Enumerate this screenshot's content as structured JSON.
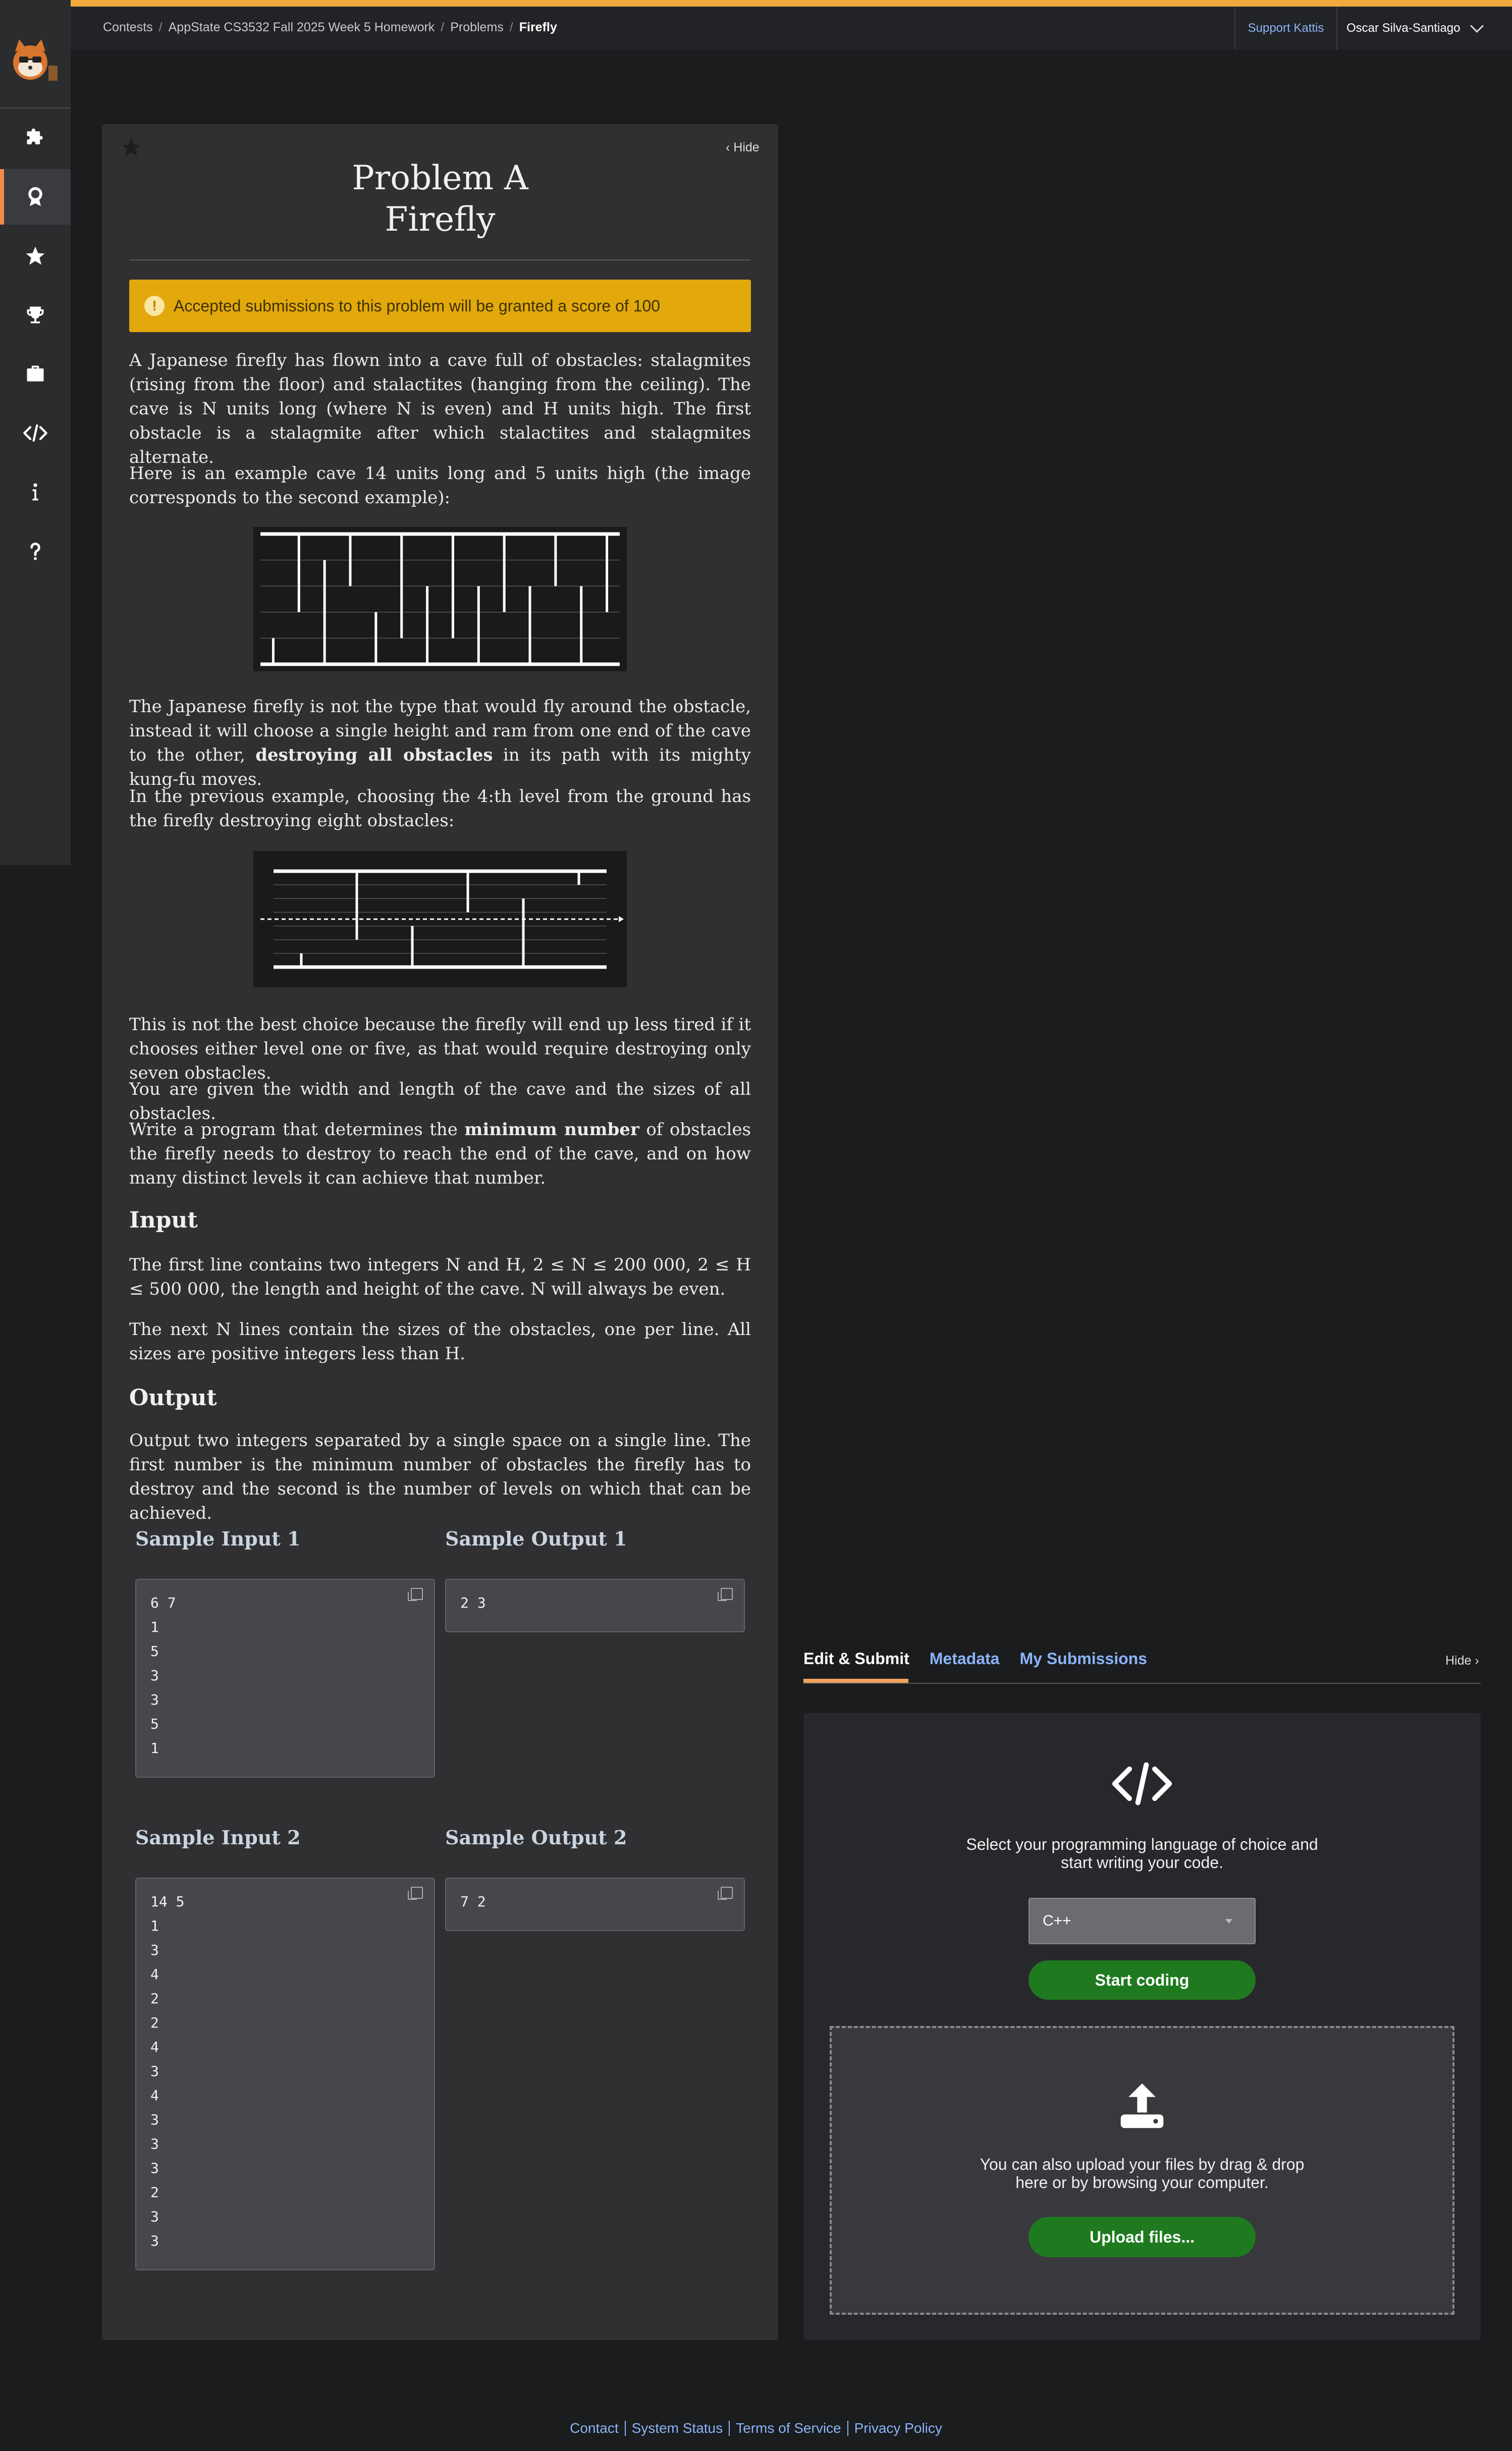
{
  "breadcrumb": {
    "contests": "Contests",
    "contest": "AppState CS3532 Fall 2025 Week 5 Homework",
    "problems": "Problems",
    "current": "Firefly",
    "sep": "/"
  },
  "header": {
    "support": "Support Kattis",
    "user": "Oscar Silva-Santiago"
  },
  "sidebar": {
    "items": [
      {
        "icon": "puzzle-icon"
      },
      {
        "icon": "award-icon",
        "active": true
      },
      {
        "icon": "star-icon"
      },
      {
        "icon": "trophy-icon"
      },
      {
        "icon": "briefcase-icon"
      },
      {
        "icon": "code-icon",
        "label": "</>"
      },
      {
        "icon": "info-icon",
        "label": "i"
      },
      {
        "icon": "help-icon",
        "label": "?"
      }
    ]
  },
  "problem": {
    "hide_label": "Hide",
    "title_line1": "Problem A",
    "title_line2": "Firefly",
    "accepted_notice": "Accepted submissions to this problem will be granted a score of 100",
    "p1": "A Japanese firefly has flown into a cave full of obstacles: stalagmites (rising from the floor) and stalactites (hanging from the ceiling). The cave is N units long (where N is even) and H units high. The first obstacle is a stalagmite after which stalactites and stalagmites alternate.",
    "p2": "Here is an example cave 14 units long and 5 units high (the image corresponds to the second example):",
    "p3_a": "The Japanese firefly is not the type that would fly around the obstacle, instead it will choose a single height and ram from one end of the cave to the other, ",
    "p3_b": "destroying all obstacles",
    "p3_c": " in its path with its mighty kung-fu moves.",
    "p4": "In the previous example, choosing the 4:th level from the ground has the firefly destroying eight obstacles:",
    "p5": "This is not the best choice because the firefly will end up less tired if it chooses either level one or five, as that would require destroying only seven obstacles.",
    "p6": "You are given the width and length of the cave and the sizes of all obstacles.",
    "p7_a": "Write a program that determines the ",
    "p7_b": "minimum number",
    "p7_c": " of obstacles the firefly needs to destroy to reach the end of the cave, and on how many distinct levels it can achieve that number.",
    "input_heading": "Input",
    "input_p1": "The first line contains two integers N and H, 2 ≤ N ≤ 200 000, 2 ≤ H ≤ 500 000, the length and height of the cave. N will always be even.",
    "input_p2": "The next N lines contain the sizes of the obstacles, one per line. All sizes are positive integers less than H.",
    "output_heading": "Output",
    "output_p1": "Output two integers separated by a single space on a single line. The first number is the minimum number of obstacles the firefly has to destroy and the second is the number of levels on which that can be achieved."
  },
  "cave1": {
    "n": 14,
    "h": 5,
    "obstacles": [
      1,
      3,
      4,
      2,
      2,
      4,
      3,
      4,
      3,
      3,
      3,
      2,
      3,
      3
    ]
  },
  "cave2": {
    "n": 6,
    "h": 7,
    "obstacles": [
      1,
      5,
      3,
      3,
      5,
      1
    ],
    "level": 4
  },
  "samples": [
    {
      "in_title": "Sample Input 1",
      "out_title": "Sample Output 1",
      "input": "6 7\n1\n5\n3\n3\n5\n1",
      "output": "2 3"
    },
    {
      "in_title": "Sample Input 2",
      "out_title": "Sample Output 2",
      "input": "14 5\n1\n3\n4\n2\n2\n4\n3\n4\n3\n3\n3\n2\n3\n3",
      "output": "7 2"
    }
  ],
  "submit": {
    "tabs": [
      "Edit & Submit",
      "Metadata",
      "My Submissions"
    ],
    "hide_label": "Hide",
    "select_text": "Select your programming language of choice and start writing your code.",
    "language": "C++",
    "start_coding": "Start coding",
    "upload_text": "You can also upload your files by drag & drop here or by browsing your computer.",
    "upload_files": "Upload files..."
  },
  "footer": {
    "links": [
      "Contact",
      "System Status",
      "Terms of Service",
      "Privacy Policy"
    ]
  }
}
